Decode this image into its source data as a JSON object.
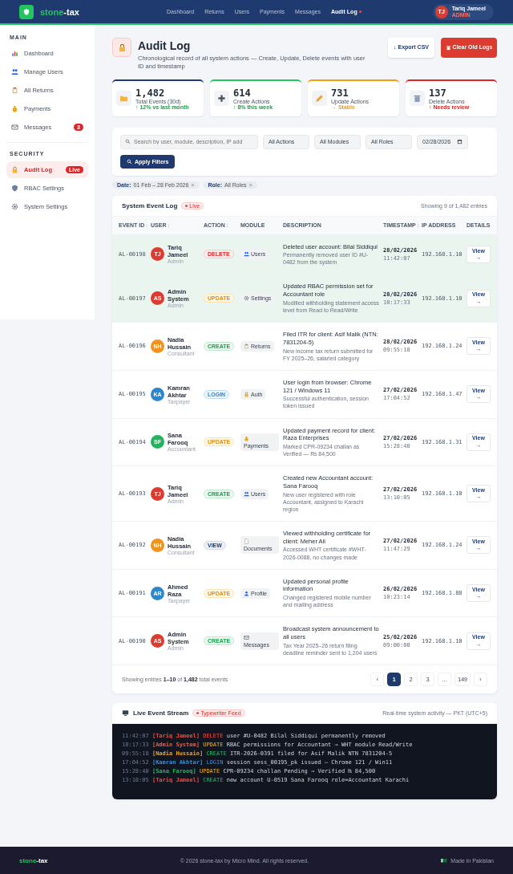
{
  "header": {
    "brand": {
      "accent": "stone",
      "rest": "-tax"
    },
    "nav": [
      {
        "label": "Dashboard",
        "selected": false
      },
      {
        "label": "Returns",
        "selected": false
      },
      {
        "label": "Users",
        "selected": false
      },
      {
        "label": "Payments",
        "selected": false
      },
      {
        "label": "Messages",
        "selected": false
      },
      {
        "label": "Audit Log",
        "selected": true
      }
    ],
    "user": {
      "initials": "TJ",
      "name": "Tariq Jameel",
      "role": "ADMIN"
    }
  },
  "sidebar": [
    {
      "title": "MAIN",
      "items": [
        {
          "kind": "dashboard",
          "label": "Dashboard",
          "selected": false
        },
        {
          "kind": "users",
          "label": "Manage Users",
          "selected": false
        },
        {
          "kind": "returns",
          "label": "All Returns",
          "selected": false
        },
        {
          "kind": "payments",
          "label": "Payments",
          "selected": false
        },
        {
          "kind": "messages",
          "label": "Messages",
          "selected": false,
          "badge": "3"
        }
      ]
    },
    {
      "title": "SECURITY",
      "items": [
        {
          "kind": "audit",
          "label": "Audit Log",
          "selected": true,
          "badge": "Live"
        },
        {
          "kind": "rbac",
          "label": "RBAC Settings",
          "selected": false
        },
        {
          "kind": "settings",
          "label": "System Settings",
          "selected": false
        }
      ]
    }
  ],
  "page": {
    "title": "Audit Log",
    "subtitle": "Chronological record of all system actions — Create, Update, Delete events with user ID and timestamp",
    "buttons": [
      {
        "kind": "secondary",
        "label": "↓ Export CSV"
      },
      {
        "kind": "danger",
        "label": "Clear Old Logs"
      }
    ]
  },
  "stats": [
    {
      "kind": "total",
      "value": "1,482",
      "label": "Total Events (30d)",
      "trend": "↑ 12% vs last month",
      "color": "#1e3a6e"
    },
    {
      "kind": "create",
      "value": "614",
      "label": "Create Actions",
      "trend": "↑ 8% this week",
      "color": "#22c55e"
    },
    {
      "kind": "update",
      "value": "731",
      "label": "Update Actions",
      "trend": "→ Stable",
      "color": "#f59e0b"
    },
    {
      "kind": "delete",
      "value": "137",
      "label": "Delete Actions",
      "trend": "↑ Needs review",
      "color": "#dc2626"
    }
  ],
  "filters": {
    "search": {
      "placeholder": "Search by user, module, description, IP add"
    },
    "selects": [
      "All Actions",
      "All Modules",
      "All Roles"
    ],
    "date": "02/28/2026",
    "apply": "Apply Filters",
    "chips": [
      {
        "key": "Date:",
        "value": "01 Feb – 28 Feb 2026",
        "remove": "×"
      },
      {
        "key": "Role:",
        "value": "All Roles",
        "remove": "×"
      }
    ]
  },
  "table": {
    "title": "System Event Log",
    "live": "Live",
    "count": "Showing 9 of 1,482 entries",
    "columns": [
      {
        "label": "EVENT ID",
        "sort": "↓"
      },
      {
        "label": "USER",
        "sort": "↕"
      },
      {
        "label": "ACTION",
        "sort": "↕"
      },
      {
        "label": "MODULE"
      },
      {
        "label": "DESCRIPTION"
      },
      {
        "label": "TIMESTAMP",
        "sort": "↕"
      },
      {
        "label": "IP ADDRESS"
      },
      {
        "label": "DETAILS"
      }
    ],
    "rows": [
      {
        "id": "AL-00198",
        "highlighted": true,
        "user": {
          "initials": "TJ",
          "name": "Tariq Jameel",
          "role": "Admin",
          "color": "#dc3b2f"
        },
        "action": {
          "label": "DELETE",
          "kind": "delete"
        },
        "module": {
          "kind": "users",
          "label": "Users"
        },
        "title": "Deleted user account: Bilal Siddiqui",
        "detail": "Permanently removed user ID #U-0482 from the system",
        "date": "28/02/2026",
        "time": "11:42:07",
        "ip": "192.168.1.10",
        "view": "View →"
      },
      {
        "id": "AL-00197",
        "highlighted": true,
        "user": {
          "initials": "AS",
          "name": "Admin System",
          "role": "Admin",
          "color": "#dc3b2f"
        },
        "action": {
          "label": "UPDATE",
          "kind": "update"
        },
        "module": {
          "kind": "settings",
          "label": "Settings"
        },
        "title": "Updated RBAC permission set for Accountant role",
        "detail": "Modified withholding statement access level from Read to Read/Write",
        "date": "28/02/2026",
        "time": "10:17:33",
        "ip": "192.168.1.10",
        "view": "View →"
      },
      {
        "id": "AL-00196",
        "highlighted": false,
        "user": {
          "initials": "NH",
          "name": "Nadia Hussain",
          "role": "Consultant",
          "color": "#f0931e"
        },
        "action": {
          "label": "CREATE",
          "kind": "create"
        },
        "module": {
          "kind": "returns",
          "label": "Returns"
        },
        "title": "Filed ITR for client: Asif Malik (NTN: 7831204-5)",
        "detail": "New income tax return submitted for FY 2025–26, salaried category",
        "date": "28/02/2026",
        "time": "09:55:18",
        "ip": "192.168.1.24",
        "view": "View →"
      },
      {
        "id": "AL-00195",
        "highlighted": false,
        "user": {
          "initials": "KA",
          "name": "Kamran Akhtar",
          "role": "Taxpayer",
          "color": "#2f86c8"
        },
        "action": {
          "label": "LOGIN",
          "kind": "login"
        },
        "module": {
          "kind": "auth",
          "label": "Auth"
        },
        "title": "User login from browser: Chrome 121 / Windows 11",
        "detail": "Successful authentication, session token issued",
        "date": "27/02/2026",
        "time": "17:04:52",
        "ip": "192.168.1.47",
        "view": "View →"
      },
      {
        "id": "AL-00194",
        "highlighted": false,
        "user": {
          "initials": "SF",
          "name": "Sana Farooq",
          "role": "Accountant",
          "color": "#22b35e"
        },
        "action": {
          "label": "UPDATE",
          "kind": "update"
        },
        "module": {
          "kind": "payments",
          "label": "Payments"
        },
        "title": "Updated payment record for client: Raza Enterprises",
        "detail": "Marked CPR-09234 challan as Verified — ₨ 84,500",
        "date": "27/02/2026",
        "time": "15:28:40",
        "ip": "192.168.1.31",
        "view": "View →"
      },
      {
        "id": "AL-00193",
        "highlighted": false,
        "user": {
          "initials": "TJ",
          "name": "Tariq Jameel",
          "role": "Admin",
          "color": "#dc3b2f"
        },
        "action": {
          "label": "CREATE",
          "kind": "create"
        },
        "module": {
          "kind": "users",
          "label": "Users"
        },
        "title": "Created new Accountant account: Sana Farooq",
        "detail": "New user registered with role Accountant, assigned to Karachi region",
        "date": "27/02/2026",
        "time": "13:10:05",
        "ip": "192.168.1.10",
        "view": "View →"
      },
      {
        "id": "AL-00192",
        "highlighted": false,
        "user": {
          "initials": "NH",
          "name": "Nadia Hussain",
          "role": "Consultant",
          "color": "#f0931e"
        },
        "action": {
          "label": "VIEW",
          "kind": "view"
        },
        "module": {
          "kind": "documents",
          "label": "Documents"
        },
        "title": "Viewed withholding certificate for client: Meher Ali",
        "detail": "Accessed WHT certificate #WHT-2026-0088, no changes made",
        "date": "27/02/2026",
        "time": "11:47:29",
        "ip": "192.168.1.24",
        "view": "View →"
      },
      {
        "id": "AL-00191",
        "highlighted": false,
        "user": {
          "initials": "AR",
          "name": "Ahmed Raza",
          "role": "Taxpayer",
          "color": "#2f86c8"
        },
        "action": {
          "label": "UPDATE",
          "kind": "update"
        },
        "module": {
          "kind": "profile",
          "label": "Profile"
        },
        "title": "Updated personal profile information",
        "detail": "Changed registered mobile number and mailing address",
        "date": "26/02/2026",
        "time": "10:23:14",
        "ip": "192.168.1.88",
        "view": "View →"
      },
      {
        "id": "AL-00190",
        "highlighted": false,
        "user": {
          "initials": "AS",
          "name": "Admin System",
          "role": "Admin",
          "color": "#dc3b2f"
        },
        "action": {
          "label": "CREATE",
          "kind": "create"
        },
        "module": {
          "kind": "messages",
          "label": "Messages"
        },
        "title": "Broadcast system announcement to all users",
        "detail": "Tax Year 2025–26 return filing deadline reminder sent to 1,204 users",
        "date": "25/02/2026",
        "time": "09:00:00",
        "ip": "192.168.1.10",
        "view": "View →"
      }
    ],
    "summary": "Showing entries **1–10** of **1,482** total events",
    "pages": [
      {
        "label": "‹",
        "selected": false
      },
      {
        "label": "1",
        "selected": true
      },
      {
        "label": "2",
        "selected": false
      },
      {
        "label": "3",
        "selected": false
      },
      {
        "label": "…",
        "selected": false
      },
      {
        "label": "149",
        "selected": false
      },
      {
        "label": "›",
        "selected": false
      }
    ]
  },
  "stream": {
    "title": "Live Event Stream",
    "badge": "Typewriter Feed",
    "note": "Real-time system activity — PKT (UTC+5)",
    "lines": [
      {
        "time": "11:42:07",
        "user": "[Tariq Jameel]",
        "color": "#e0524a",
        "action": "DELETE",
        "kind": "delete",
        "message": "user #U-0482 Bilal Siddiqui permanently removed"
      },
      {
        "time": "10:17:33",
        "user": "[Admin System]",
        "color": "#e0624a",
        "action": "UPDATE",
        "kind": "update",
        "message": "RBAC permissions for Accountant → WHT module Read/Write"
      },
      {
        "time": "09:55:18",
        "user": "[Nadia Hussain]",
        "color": "#e8a23a",
        "action": "CREATE",
        "kind": "create",
        "message": "ITR-2026-0391 filed for Asif Malik NTN 7831204-5"
      },
      {
        "time": "17:04:52",
        "user": "[Kamran Akhtar]",
        "color": "#3b8fd6",
        "action": "LOGIN",
        "kind": "login",
        "message": "session sess_00195_pk issued — Chrome 121 / Win11"
      },
      {
        "time": "15:28:40",
        "user": "[Sana Farooq]",
        "color": "#2fb36a",
        "action": "UPDATE",
        "kind": "update",
        "message": "CPR-09234 challan Pending → Verified ₨ 84,500"
      },
      {
        "time": "13:10:05",
        "user": "[Tariq Jameel]",
        "color": "#e0524a",
        "action": "CREATE",
        "kind": "create",
        "message": "new account U-0519 Sana Farooq role=Accountant Karachi"
      }
    ]
  },
  "footer": {
    "brand": {
      "accent": "stone",
      "rest": "-tax"
    },
    "copyright": "© 2026 stone-tax by Micro Mind. All rights reserved.",
    "made": "Made in Pakistan"
  }
}
